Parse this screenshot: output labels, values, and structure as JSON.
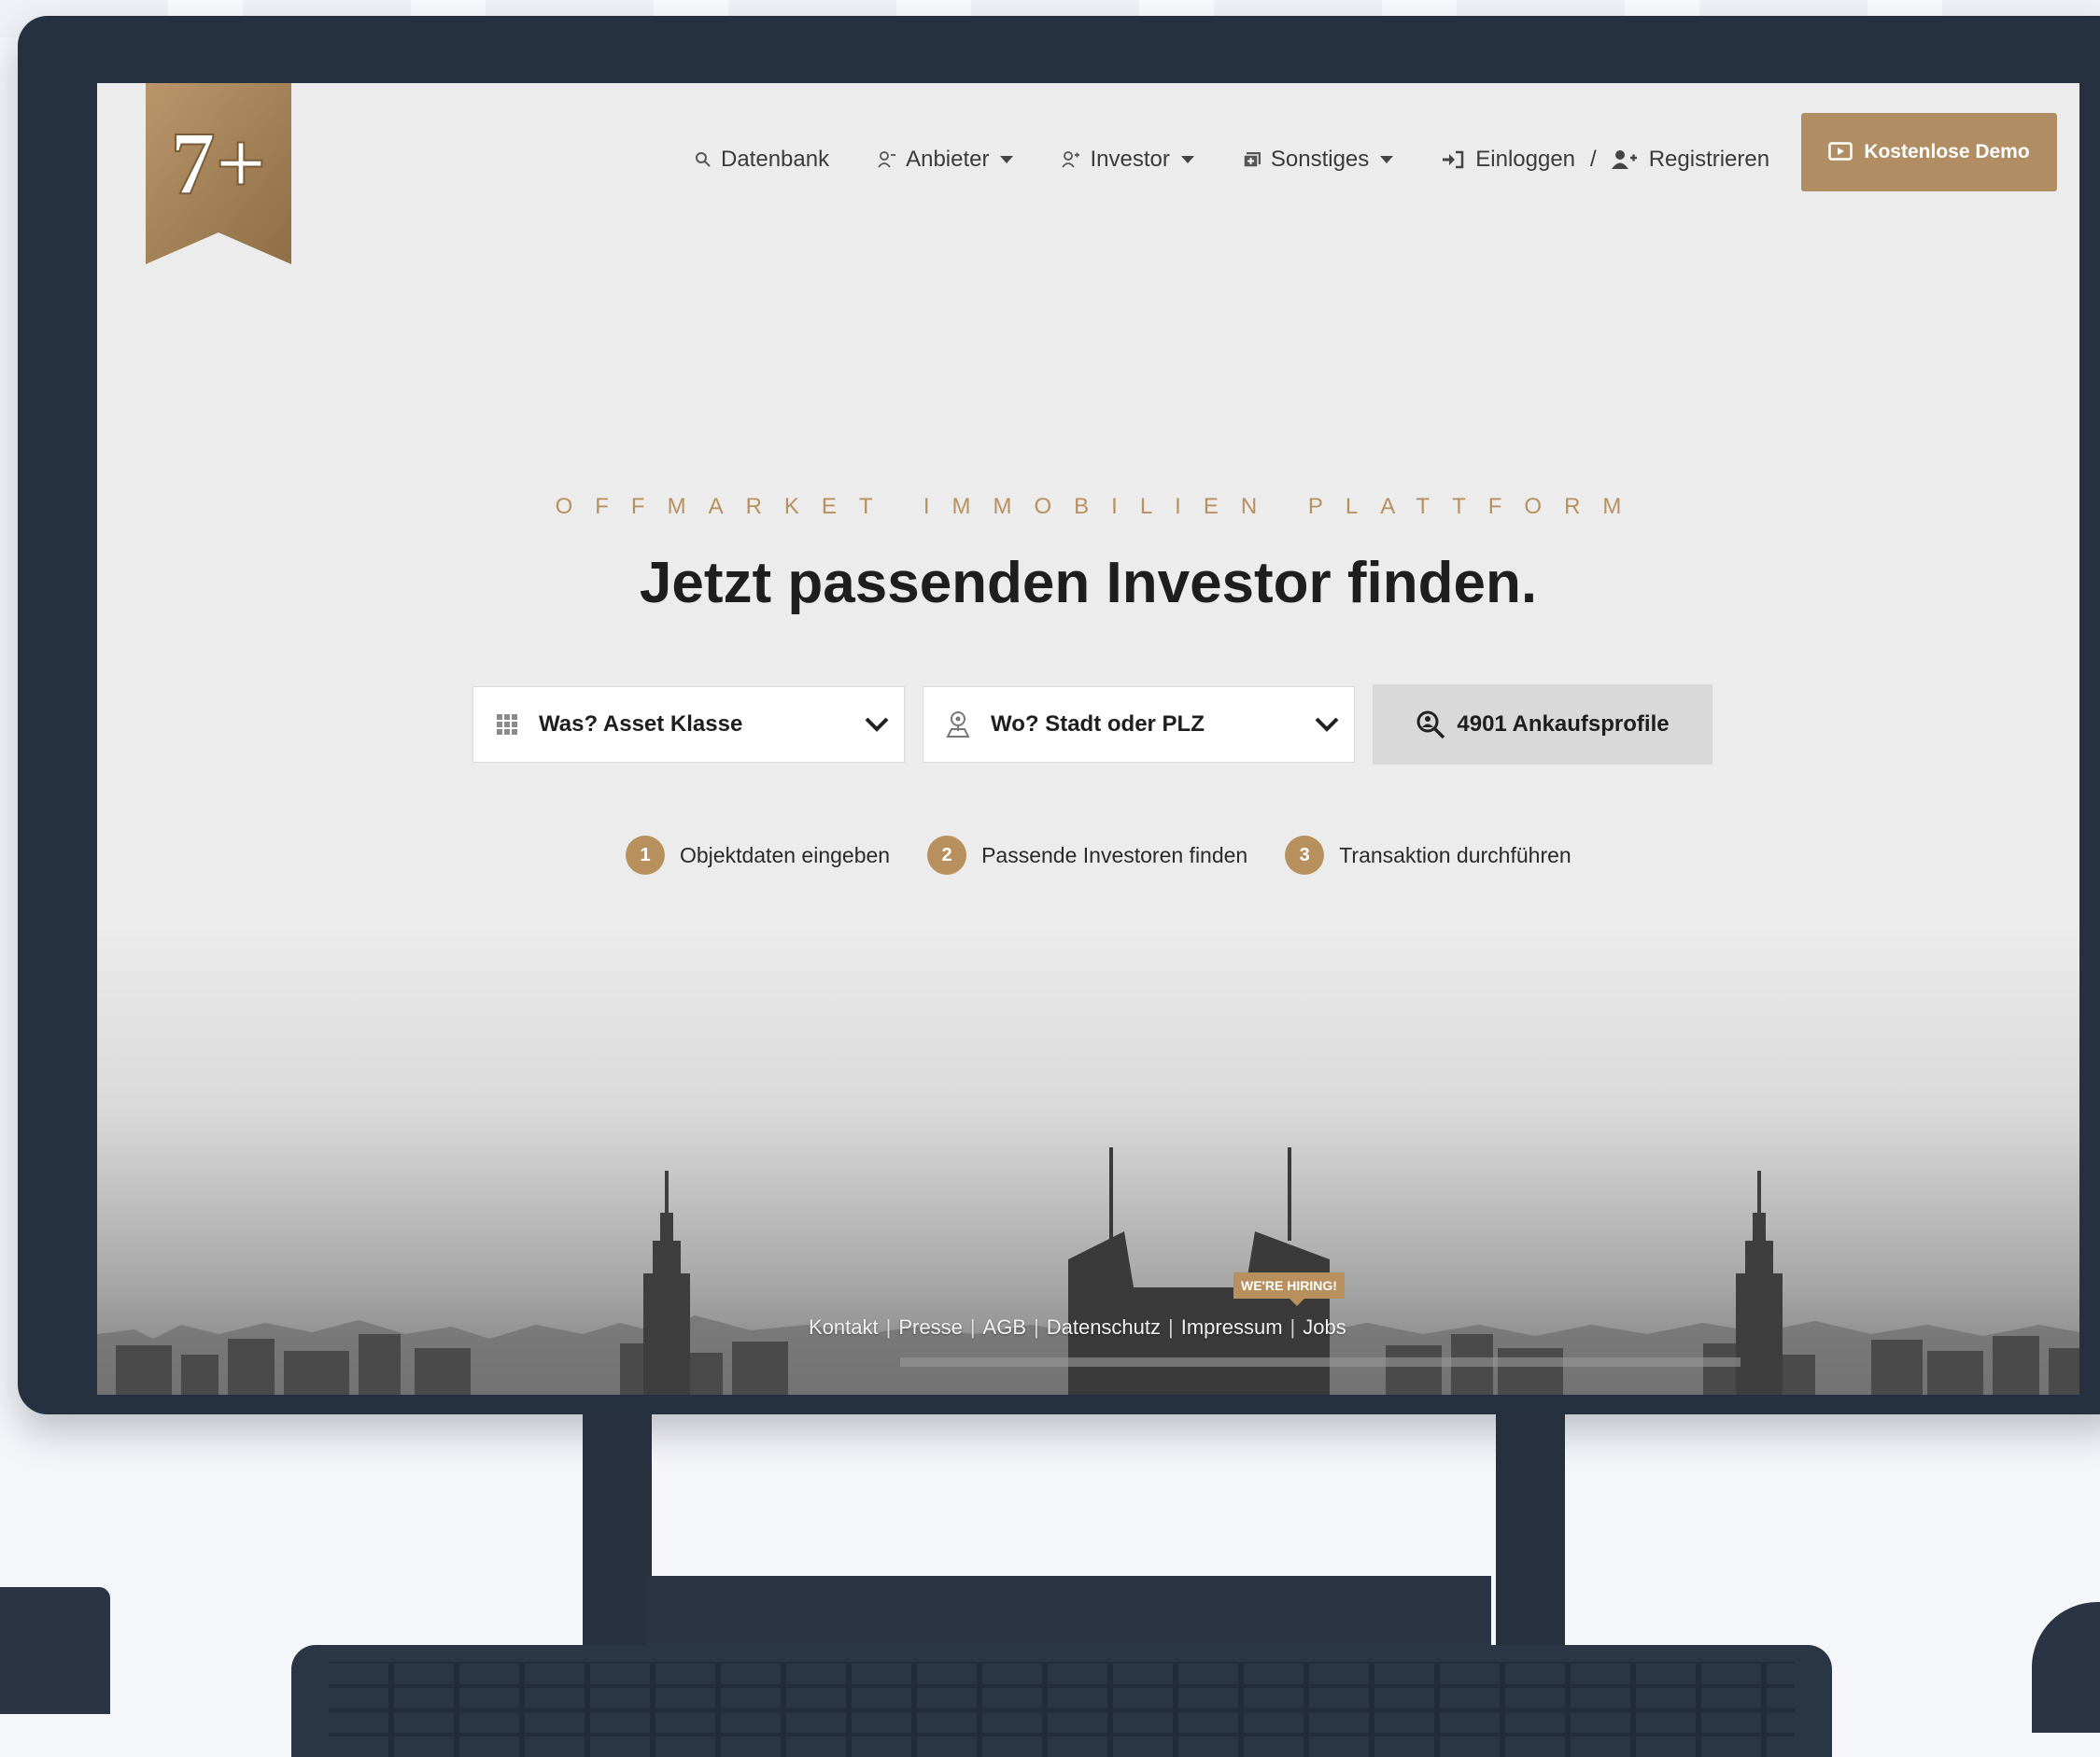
{
  "nav": {
    "database": "Datenbank",
    "provider": "Anbieter",
    "investor": "Investor",
    "other": "Sonstiges",
    "login": "Einloggen",
    "separator": "/",
    "register": "Registrieren",
    "demo": "Kostenlose Demo"
  },
  "logo_text": "7+",
  "hero": {
    "eyebrow": "OFFMARKET IMMOBILIEN PLATTFORM",
    "headline": "Jetzt passenden Investor finden."
  },
  "search": {
    "asset_placeholder": "Was? Asset Klasse",
    "location_placeholder": "Wo? Stadt oder PLZ",
    "button": "4901 Ankaufsprofile"
  },
  "steps": [
    {
      "num": "1",
      "label": "Objektdaten eingeben"
    },
    {
      "num": "2",
      "label": "Passende Investoren finden"
    },
    {
      "num": "3",
      "label": "Transaktion durchführen"
    }
  ],
  "footer": {
    "links": [
      "Kontakt",
      "Presse",
      "AGB",
      "Datenschutz",
      "Impressum",
      "Jobs"
    ],
    "separator": "|",
    "hiring": "WE'RE HIRING!"
  },
  "colors": {
    "accent": "#b08d62",
    "monitor": "#253040",
    "screen_bg": "#ececec"
  }
}
